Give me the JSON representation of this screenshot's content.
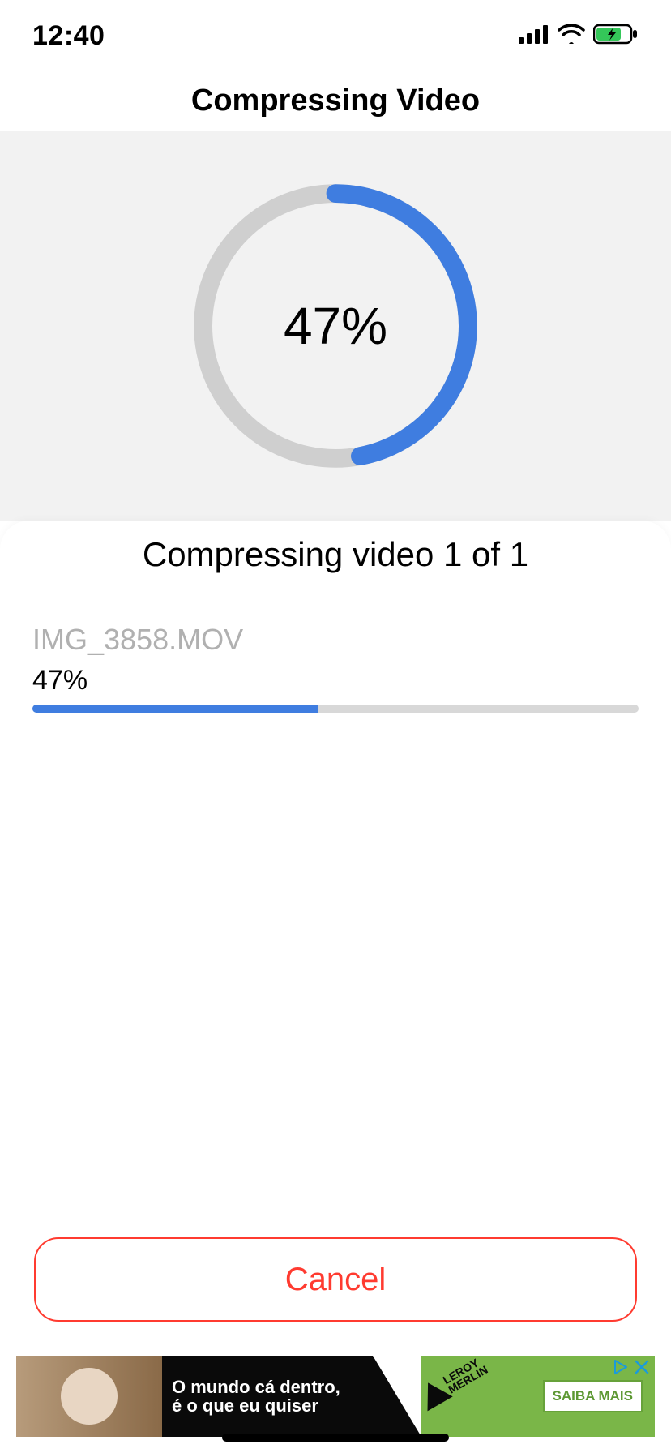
{
  "status": {
    "time": "12:40"
  },
  "header": {
    "title": "Compressing Video"
  },
  "progress": {
    "percent": 47,
    "percent_label": "47%"
  },
  "card": {
    "title": "Compressing video 1 of 1",
    "file_name": "IMG_3858.MOV",
    "file_percent": 47,
    "file_percent_label": "47%"
  },
  "actions": {
    "cancel_label": "Cancel"
  },
  "ad": {
    "line1": "O mundo cá dentro,",
    "line2": "é o que eu quiser",
    "brand_top": "LEROY",
    "brand_bottom": "MERLIN",
    "cta": "SAIBA MAIS"
  },
  "colors": {
    "accent_blue": "#3f7de0",
    "track_grey": "#cfcfcf",
    "cancel_red": "#ff3b30",
    "ad_green": "#7ab648"
  }
}
